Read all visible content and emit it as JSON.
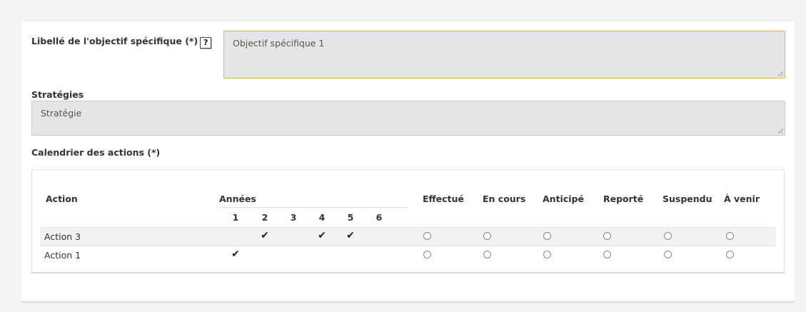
{
  "objective": {
    "label": "Libellé de l'objectif spécifique (*)",
    "help_glyph": "?",
    "value": "Objectif spécifique 1"
  },
  "strategies": {
    "label": "Stratégies",
    "value": "Stratégie"
  },
  "calendar": {
    "label": "Calendrier des actions (*)",
    "headers": {
      "action": "Action",
      "years": "Années",
      "statuses": [
        "Effectué",
        "En cours",
        "Anticipé",
        "Reporté",
        "Suspendu",
        "À venir"
      ]
    },
    "years": [
      "1",
      "2",
      "3",
      "4",
      "5",
      "6"
    ],
    "rows": [
      {
        "name": "Action 3",
        "years_checked": [
          false,
          true,
          false,
          true,
          true,
          false
        ],
        "status_selected": null
      },
      {
        "name": "Action 1",
        "years_checked": [
          true,
          false,
          false,
          false,
          false,
          false
        ],
        "status_selected": null
      }
    ],
    "check_glyph": "✔"
  },
  "colors": {
    "focused_border": "#e8b54a",
    "field_bg": "#e5e5e5",
    "stripe": "#f2f2f2"
  }
}
